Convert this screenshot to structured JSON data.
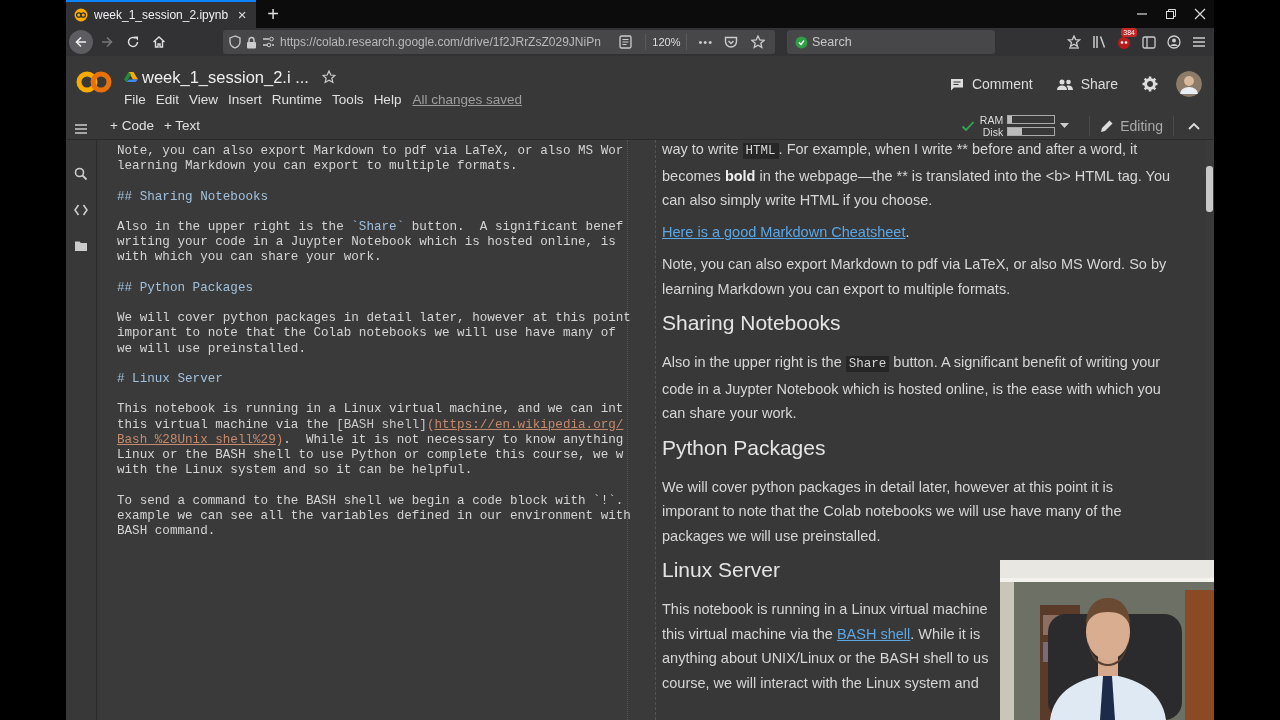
{
  "browser": {
    "tab": {
      "title": "week_1_session_2.ipynb",
      "close": "×"
    },
    "new_tab": "+",
    "url": "https://colab.research.google.com/drive/1f2JRrZsZ029JNiPn",
    "zoom": "120%",
    "more": "•••",
    "search": {
      "placeholder": "Search"
    },
    "badge": "384"
  },
  "notebook": {
    "title": "week_1_session_2.i ...",
    "menu": [
      "File",
      "Edit",
      "View",
      "Insert",
      "Runtime",
      "Tools",
      "Help"
    ],
    "save_status": "All changes saved",
    "actions": [
      {
        "kind": "comment",
        "label": "Comment"
      },
      {
        "kind": "share",
        "label": "Share"
      }
    ]
  },
  "toolbar": {
    "add": [
      "+ Code",
      "+ Text"
    ],
    "resources": [
      {
        "label": "RAM",
        "level": 0.08
      },
      {
        "label": "Disk",
        "level": 0.3
      }
    ],
    "mode": "Editing"
  },
  "editor": {
    "blocks": [
      [
        [
          {
            "kind": "text",
            "text": "Note, you can also export Markdown to pdf via LaTeX, or also MS Wor"
          }
        ],
        [
          {
            "kind": "text",
            "text": "learning Markdown you can export to multiple formats."
          }
        ]
      ],
      [
        [
          {
            "kind": "heading",
            "text": "## Sharing Notebooks"
          }
        ]
      ],
      [
        [
          {
            "kind": "text",
            "text": "Also in the upper right is the "
          },
          {
            "kind": "code",
            "text": "`Share`"
          },
          {
            "kind": "text",
            "text": " button.  A significant benef"
          }
        ],
        [
          {
            "kind": "text",
            "text": "writing your code in a Juypter Notebook which is hosted online, is"
          }
        ],
        [
          {
            "kind": "text",
            "text": "with which you can share your work."
          }
        ]
      ],
      [
        [
          {
            "kind": "heading",
            "text": "## Python Packages"
          }
        ]
      ],
      [
        [
          {
            "kind": "text",
            "text": "We will cover python packages in detail later, however at this point"
          }
        ],
        [
          {
            "kind": "text",
            "text": "imporant to note that the Colab notebooks we will use have many of"
          }
        ],
        [
          {
            "kind": "text",
            "text": "we will use preinstalled."
          }
        ]
      ],
      [
        [
          {
            "kind": "heading",
            "text": "# Linux Server"
          }
        ]
      ],
      [
        [
          {
            "kind": "text",
            "text": "This notebook is running in a Linux virtual machine, and we can int"
          }
        ],
        [
          {
            "kind": "text",
            "text": "this virtual machine via the "
          },
          {
            "kind": "bracket",
            "text": "[BASH shell]"
          },
          {
            "kind": "paren",
            "text": "("
          },
          {
            "kind": "url",
            "text": "https://en.wikipedia.org/"
          }
        ],
        [
          {
            "kind": "url",
            "text": "Bash_%28Unix_shell%29"
          },
          {
            "kind": "paren",
            "text": ")"
          },
          {
            "kind": "text",
            "text": ".  While it is not necessary to know anything"
          }
        ],
        [
          {
            "kind": "text",
            "text": "Linux or the BASH shell to use Python or complete this course, we w"
          }
        ],
        [
          {
            "kind": "text",
            "text": "with the Linux system and so it can be helpful."
          }
        ]
      ],
      [
        [
          {
            "kind": "text",
            "text": "To send a command to the BASH shell we begin a code block with `!`."
          }
        ],
        [
          {
            "kind": "text",
            "text": "example we can see all the variables defined in our environment with"
          }
        ],
        [
          {
            "kind": "text",
            "text": "BASH command."
          }
        ]
      ]
    ]
  },
  "preview": {
    "items": [
      {
        "kind": "paragraph",
        "lines": [
          [
            {
              "kind": "text",
              "text": "way to write "
            },
            {
              "kind": "code",
              "text": "HTML"
            },
            {
              "kind": "text",
              "text": ". For example, when I write ** before and after a word, it"
            }
          ],
          [
            {
              "kind": "text",
              "text": "becomes "
            },
            {
              "kind": "bold",
              "text": "bold"
            },
            {
              "kind": "text",
              "text": " in the webpage—the ** is translated into the <b> HTML tag. You"
            }
          ],
          [
            {
              "kind": "text",
              "text": "can also simply write HTML if you choose."
            }
          ]
        ]
      },
      {
        "kind": "paragraph",
        "lines": [
          [
            {
              "kind": "link",
              "text": "Here is a good Markdown Cheatsheet"
            },
            {
              "kind": "text",
              "text": "."
            }
          ]
        ]
      },
      {
        "kind": "paragraph",
        "lines": [
          [
            {
              "kind": "text",
              "text": "Note, you can also export Markdown to pdf via LaTeX, or also MS Word. So by"
            }
          ],
          [
            {
              "kind": "text",
              "text": "learning Markdown you can export to multiple formats."
            }
          ]
        ]
      },
      {
        "kind": "heading",
        "text": "Sharing Notebooks"
      },
      {
        "kind": "paragraph",
        "lines": [
          [
            {
              "kind": "text",
              "text": "Also in the upper right is the "
            },
            {
              "kind": "code",
              "text": "Share"
            },
            {
              "kind": "text",
              "text": " button. A significant benefit of writing your"
            }
          ],
          [
            {
              "kind": "text",
              "text": "code in a Juypter Notebook which is hosted online, is the ease with which you"
            }
          ],
          [
            {
              "kind": "text",
              "text": "can share your work."
            }
          ]
        ]
      },
      {
        "kind": "heading",
        "text": "Python Packages"
      },
      {
        "kind": "paragraph",
        "lines": [
          [
            {
              "kind": "text",
              "text": "We will cover python packages in detail later, however at this point it is"
            }
          ],
          [
            {
              "kind": "text",
              "text": "imporant to note that the Colab notebooks we will use have many of the"
            }
          ],
          [
            {
              "kind": "text",
              "text": "packages we will use preinstalled."
            }
          ]
        ]
      },
      {
        "kind": "heading",
        "text": "Linux Server"
      },
      {
        "kind": "paragraph",
        "lines": [
          [
            {
              "kind": "text",
              "text": "This notebook is running in a Linux virtual machine"
            }
          ],
          [
            {
              "kind": "text",
              "text": "this virtual machine via the "
            },
            {
              "kind": "link",
              "text": "BASH shell"
            },
            {
              "kind": "text",
              "text": ". While it is"
            }
          ],
          [
            {
              "kind": "text",
              "text": "anything about UNIX/Linux or the BASH shell to us"
            }
          ],
          [
            {
              "kind": "text",
              "text": "course, we will interact with the Linux system and"
            }
          ]
        ]
      }
    ]
  }
}
